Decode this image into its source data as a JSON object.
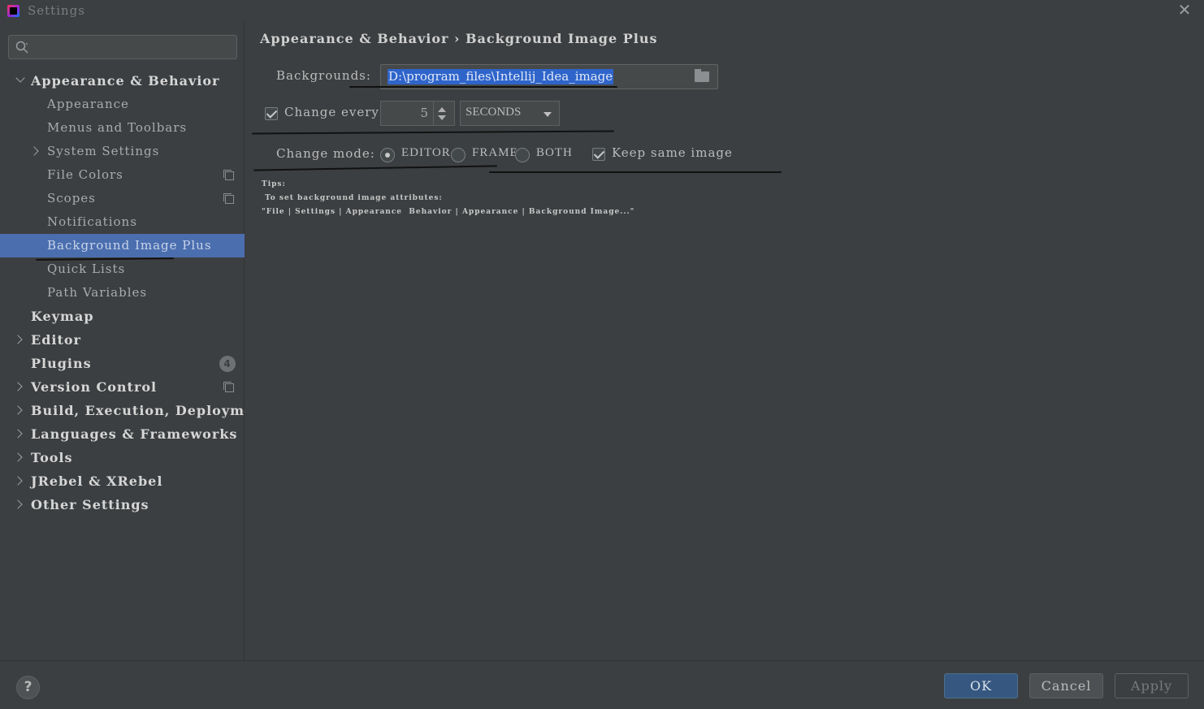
{
  "window": {
    "title": "Settings"
  },
  "search": {
    "placeholder": ""
  },
  "sidebar": {
    "items": [
      {
        "label": "Appearance & Behavior"
      },
      {
        "label": "Appearance"
      },
      {
        "label": "Menus and Toolbars"
      },
      {
        "label": "System Settings"
      },
      {
        "label": "File Colors"
      },
      {
        "label": "Scopes"
      },
      {
        "label": "Notifications"
      },
      {
        "label": "Background Image Plus"
      },
      {
        "label": "Quick Lists"
      },
      {
        "label": "Path Variables"
      },
      {
        "label": "Keymap"
      },
      {
        "label": "Editor"
      },
      {
        "label": "Plugins",
        "badge": "4"
      },
      {
        "label": "Version Control"
      },
      {
        "label": "Build, Execution, Deployment"
      },
      {
        "label": "Languages & Frameworks"
      },
      {
        "label": "Tools"
      },
      {
        "label": "JRebel & XRebel"
      },
      {
        "label": "Other Settings"
      }
    ]
  },
  "main": {
    "breadcrumb": "Appearance & Behavior › Background Image Plus",
    "backgrounds_label": "Backgrounds:",
    "backgrounds_value": "D:\\program_files\\Intellij_Idea_image",
    "change_every_label": "Change every:",
    "change_every_value": "5",
    "change_every_unit": "SECONDS",
    "change_mode_label": "Change mode:",
    "mode_options": [
      "EDITOR",
      "FRAME",
      "BOTH"
    ],
    "mode_selected": "EDITOR",
    "keep_same_label": "Keep same image",
    "tips": "Tips:\n To set background image attributes:\n\"File | Settings | Appearance  Behavior | Appearance | Background Image...\""
  },
  "footer": {
    "help": "?",
    "ok": "OK",
    "cancel": "Cancel",
    "apply": "Apply"
  },
  "colors": {
    "selection": "#4b6eaf",
    "ok_button": "#365880",
    "text_selection": "#2f65ca"
  }
}
